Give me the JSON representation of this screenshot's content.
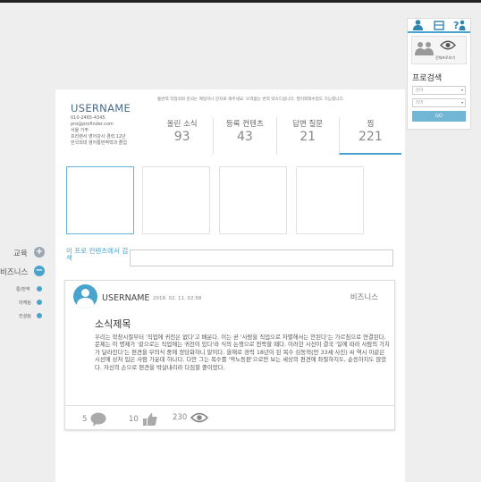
{
  "profile": {
    "username": "USERNAME",
    "info_lines": [
      "010-2465-4345",
      "pro@profinder.com",
      "서울 거주",
      "프리랜서 영어강사 경력 12년",
      "한국외대 영어통번역학과 졸업"
    ],
    "notice": "통번역 작업의뢰 문의는 메일이나 문자로 해주세요. 오역없는 번역 약속드립니다.  영어회화수업도 가능합니다."
  },
  "stats": [
    {
      "label": "올린 소식",
      "value": "93"
    },
    {
      "label": "등록 컨텐츠",
      "value": "43"
    },
    {
      "label": "답변 질문",
      "value": "21"
    },
    {
      "label": "찜",
      "value": "221"
    }
  ],
  "search": {
    "label": "이 프로 컨텐츠에서 검색",
    "placeholder": ""
  },
  "post": {
    "username": "USERNAME",
    "date": "2018. 02. 11. 02:58",
    "category": "비즈니스",
    "title": "소식제목",
    "body": "우리는 학창시절부터 '직업에 귀천은 없다'고 배운다. 이는 곧 '사람을 직업으로 차별해서는 안된다'는 가르침으로 연결된다. 문제는 이 명제가 '겉으로는 직업에는 귀천이 있다'라 식의 논쟁으로 전락할 때다. 이러한 시선이 결국 '일에 따라 사람의 가치가 달라진다'는 편견을 무의식 중에 정당화하니 말이다. 올해로 경력 18년이 된 목수 김동혁(만 33세·사진) 씨 역시 이같은 시선에 상처 입은 사람 가운데 하나다. 다만 그는 목수를 '막노동판'으로만 보는 세상의 편견에 좌절하지도, 순응하지도 않았다. 자신의 손으로 편견을 박살내리라 다짐할 뿐이었다.",
    "comments": "5",
    "likes": "10",
    "views": "230"
  },
  "left_nav": {
    "education": "교육",
    "business": "비즈니스",
    "sub_items": [
      "통/번역",
      "마케팅",
      "컨설팅"
    ]
  },
  "right_panel": {
    "preview_label": "전체프로보기",
    "title": "프로검색",
    "select1": "분야",
    "select2": "지역",
    "go": "GO"
  },
  "colors": {
    "accent": "#4aa3cc",
    "nav_plus": "#9aa7b0"
  }
}
